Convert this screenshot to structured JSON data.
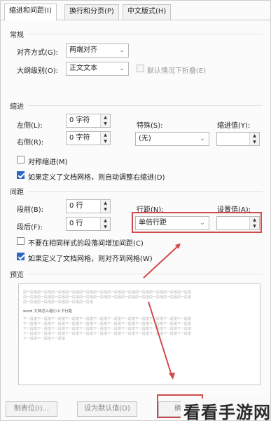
{
  "tabs": [
    {
      "label": "缩进和间距(I)"
    },
    {
      "label": "换行和分页(P)"
    },
    {
      "label": "中文版式(H)"
    }
  ],
  "general": {
    "title": "常规",
    "alignment": {
      "label": "对齐方式(G):",
      "value": "两端对齐"
    },
    "outline": {
      "label": "大纲级别(O):",
      "value": "正文文本"
    },
    "collapse": {
      "label": "默认情况下折叠(E)"
    }
  },
  "indent": {
    "title": "缩进",
    "left": {
      "label": "左侧(L):",
      "value": "0 字符"
    },
    "right": {
      "label": "右侧(R):",
      "value": "0 字符"
    },
    "special": {
      "label": "特殊(S):",
      "value": "(无)"
    },
    "indent_value": {
      "label": "缩进值(Y):",
      "value": ""
    },
    "mirror": {
      "label": "对称缩进(M)"
    },
    "auto_adjust": {
      "label": "如果定义了文档网格，则自动调整右缩进(D)"
    }
  },
  "spacing": {
    "title": "间距",
    "before": {
      "label": "段前(B):",
      "value": "0 行"
    },
    "after": {
      "label": "段后(F):",
      "value": "0 行"
    },
    "line": {
      "label": "行距(N):",
      "value": "单倍行距"
    },
    "set_value": {
      "label": "设置值(A):",
      "value": ""
    },
    "no_space_same": {
      "label": "不要在相同样式的段落间增加间距(C)"
    },
    "snap_grid": {
      "label": "如果定义了文档网格，则对齐到网格(W)"
    }
  },
  "preview": {
    "title": "预览",
    "prev_lines": [
      "前一段落前一段落前一段落前一段落前一段落前一段落前一段落前一段落前一段落前一段落前一段落前一段落",
      "前一段落前一段落前一段落前一段落前一段落前一段落前一段落前一段落前一段落前一段落前一段落前一段落",
      "前一段落前一段落前一段落前一段落前一段落"
    ],
    "main_line": "word 文档怎么缩小上下行距",
    "next_lines": [
      "下一段落下一段落下一段落下一段落下一段落下一段落下一段落下一段落下一段落下一段落下一段落下一段落",
      "下一段落下一段落下一段落下一段落下一段落下一段落下一段落下一段落下一段落下一段落下一段落下一段落",
      "下一段落下一段落下一段落下一段落下一段落下一段落下一段落下一段落下一段落下一段落下一段落下一段落",
      "下一段落下一段落下一段落下一段落下一段落下一段落下一段落下一段落下一段落下一段落下一段落下一段落",
      "下一段落下一段落下一段落"
    ]
  },
  "buttons": {
    "tabs_button": "制表位(I)...",
    "default_button": "设为默认值(D)",
    "ok_button": "确"
  },
  "watermark": "看看手游网",
  "colors": {
    "highlight": "#d44a4a",
    "accent": "#2a67c7"
  }
}
